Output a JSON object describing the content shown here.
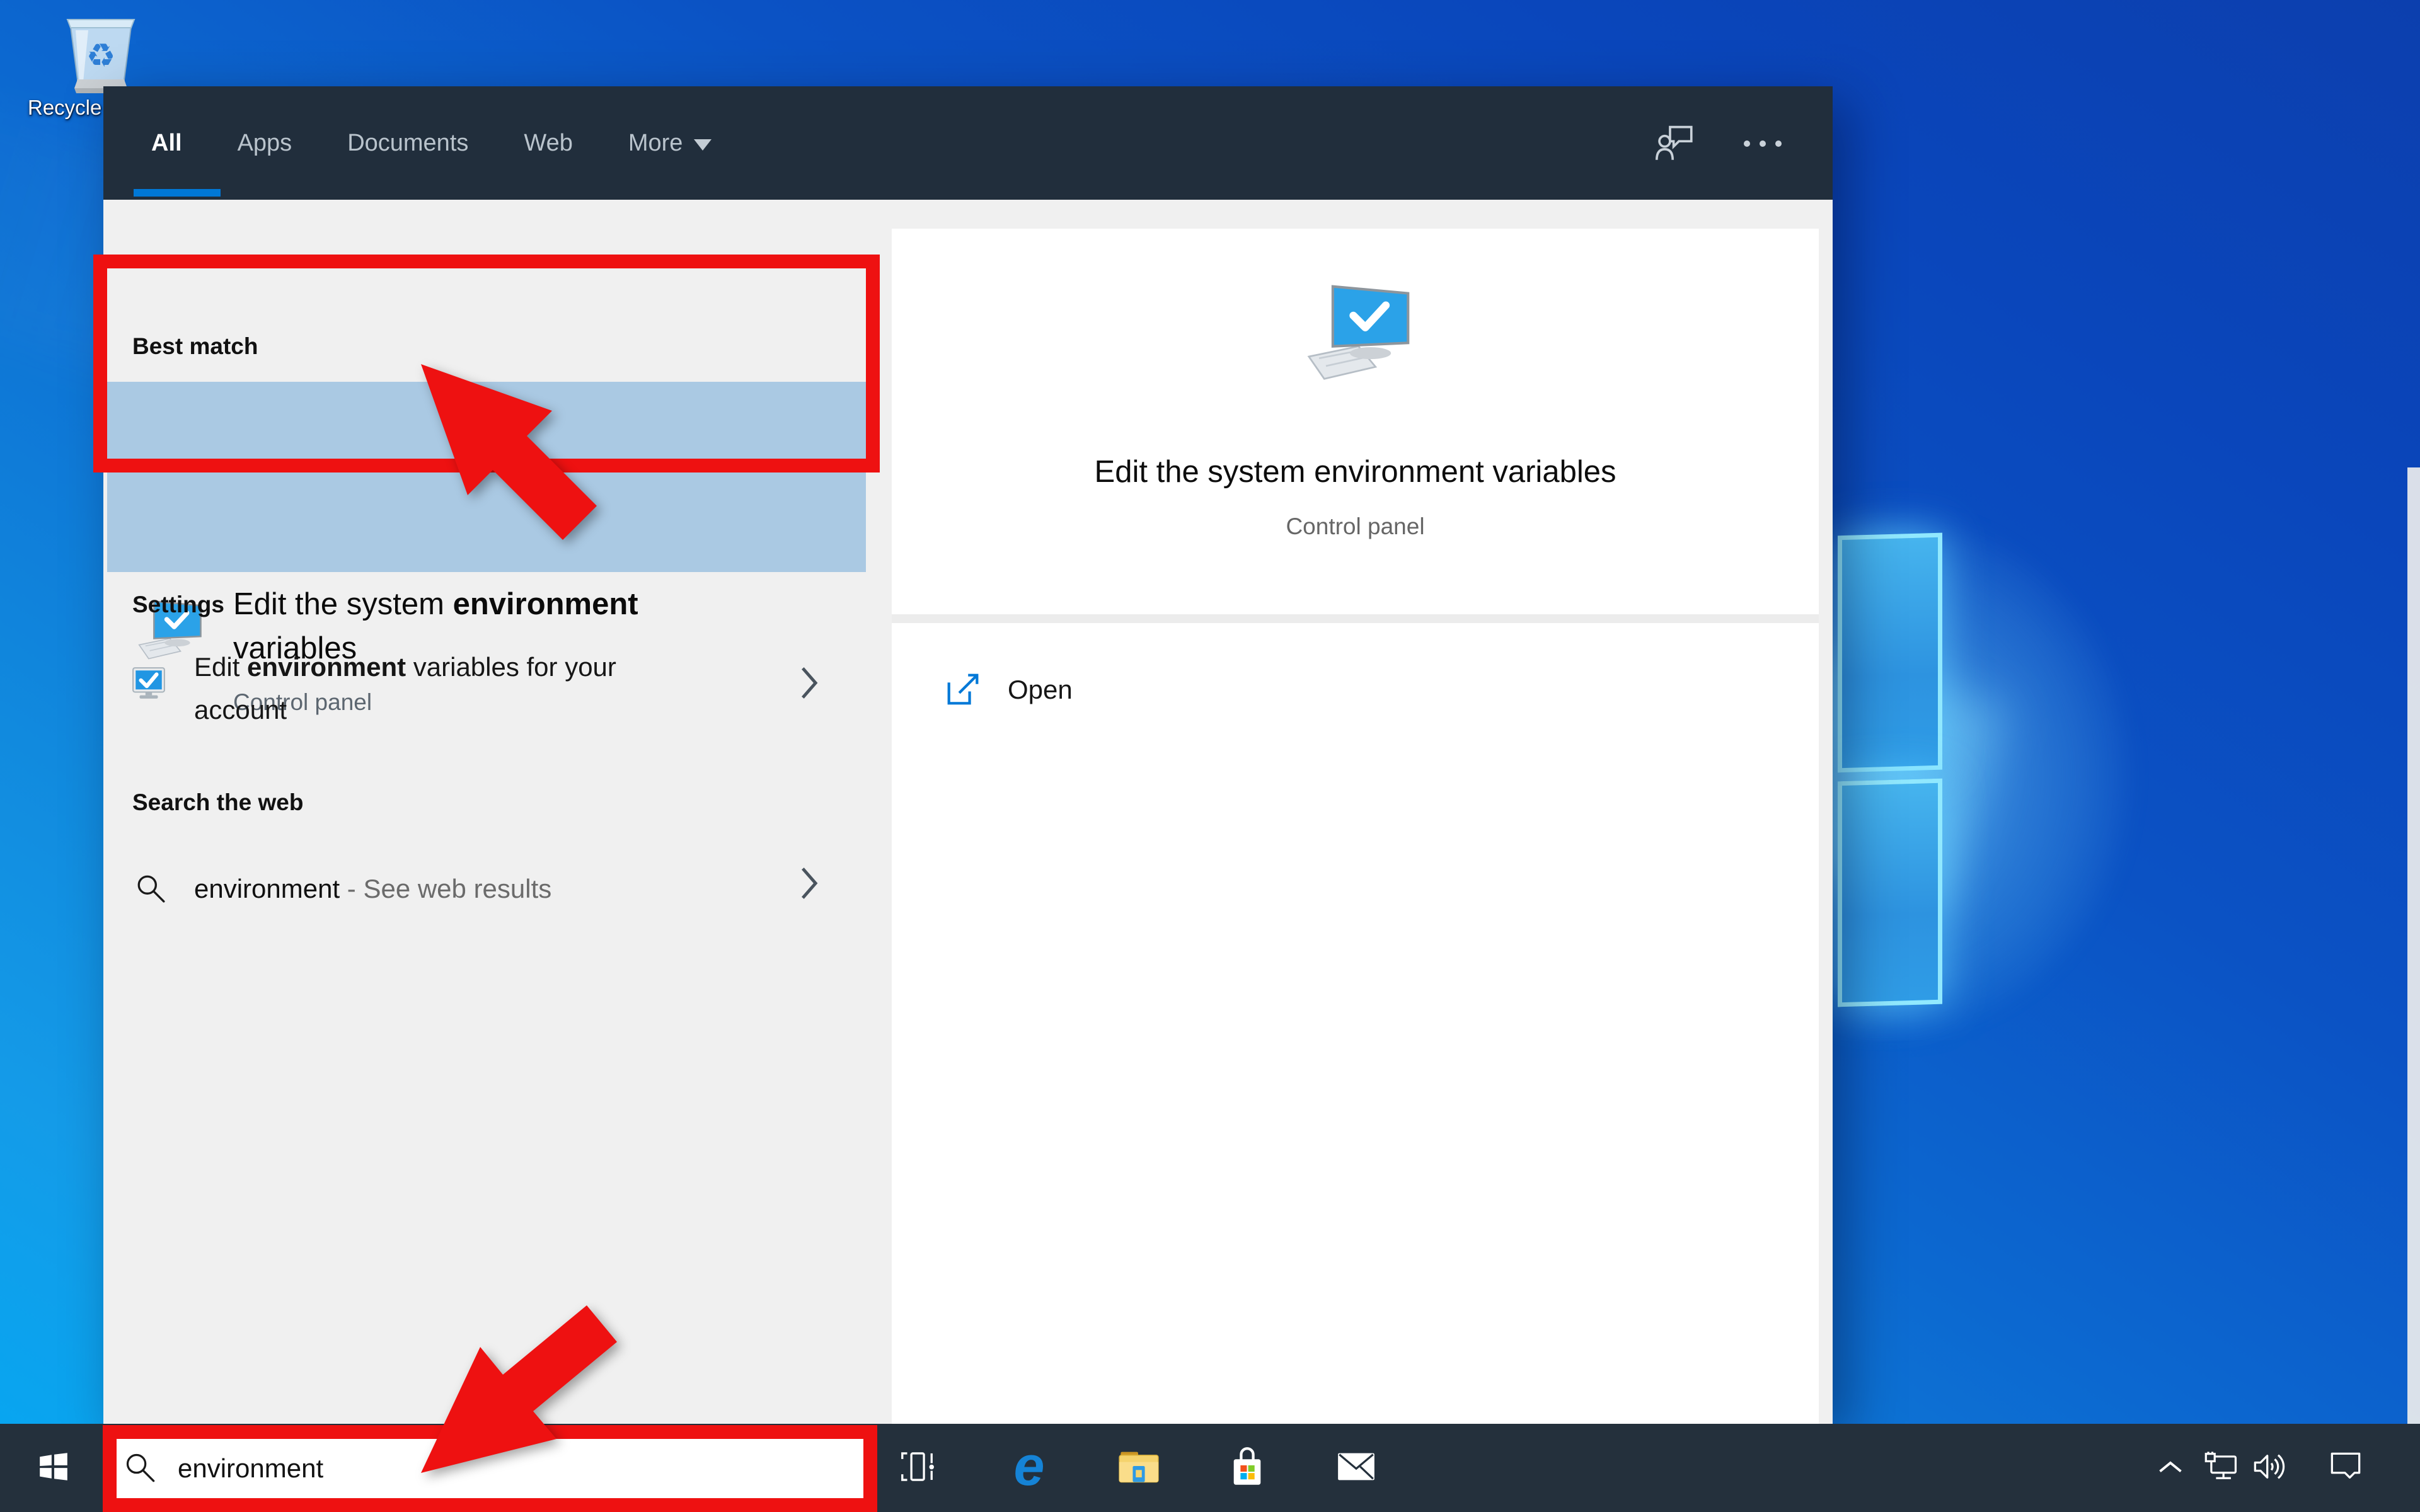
{
  "desktop": {
    "recycle_bin_label": "Recycle Bin"
  },
  "search_window": {
    "tabs": [
      {
        "label": "All",
        "active": true
      },
      {
        "label": "Apps",
        "active": false
      },
      {
        "label": "Documents",
        "active": false
      },
      {
        "label": "Web",
        "active": false
      },
      {
        "label": "More",
        "active": false,
        "has_caret": true
      }
    ],
    "header_icons": [
      "user-feedback-icon",
      "ellipsis-icon"
    ],
    "sections": {
      "best_match": {
        "heading": "Best match",
        "title_prefix": "Edit the system ",
        "title_match": "environment",
        "title_suffix": " variables",
        "subtitle": "Control panel",
        "icon": "computer-check-icon"
      },
      "settings": {
        "heading": "Settings",
        "item_prefix": "Edit ",
        "item_match": "environment",
        "item_suffix": " variables for your account",
        "icon": "monitor-check-icon"
      },
      "web": {
        "heading": "Search the web",
        "query": "environment",
        "rest": " - See web results",
        "icon": "search-icon"
      }
    },
    "preview": {
      "title": "Edit the system environment variables",
      "subtitle": "Control panel",
      "icon": "computer-check-icon",
      "open_label": "Open",
      "open_icon": "open-external-icon"
    }
  },
  "taskbar": {
    "search": {
      "value": "environment",
      "icon": "search-icon"
    },
    "pinned": [
      "task-view",
      "edge-browser",
      "file-explorer",
      "microsoft-store",
      "mail"
    ],
    "tray": [
      "tray-expand-chevron",
      "network-ethernet",
      "volume",
      "action-center"
    ]
  },
  "annotations": {
    "color": "#ee1111",
    "box_targets": [
      "best-match-result",
      "taskbar-search-box"
    ],
    "arrow_count": 2
  },
  "colors": {
    "accent": "#0078d7",
    "header_bg": "#212e3c",
    "taskbar_bg": "#24303c",
    "panel_bg": "#f0f0f0",
    "card_bg": "#ffffff",
    "highlight_bg": "#aac9e3",
    "annotation_red": "#ee1111",
    "text_dark": "#161616",
    "text_gray": "#5c6670",
    "tab_inactive": "#b9c3cc",
    "wallpaper_bright": "#05a8f2",
    "wallpaper_deep": "#0a46bb",
    "logo_pane_fill": "#2d93e0",
    "logo_pane_edge": "#96ecff"
  }
}
